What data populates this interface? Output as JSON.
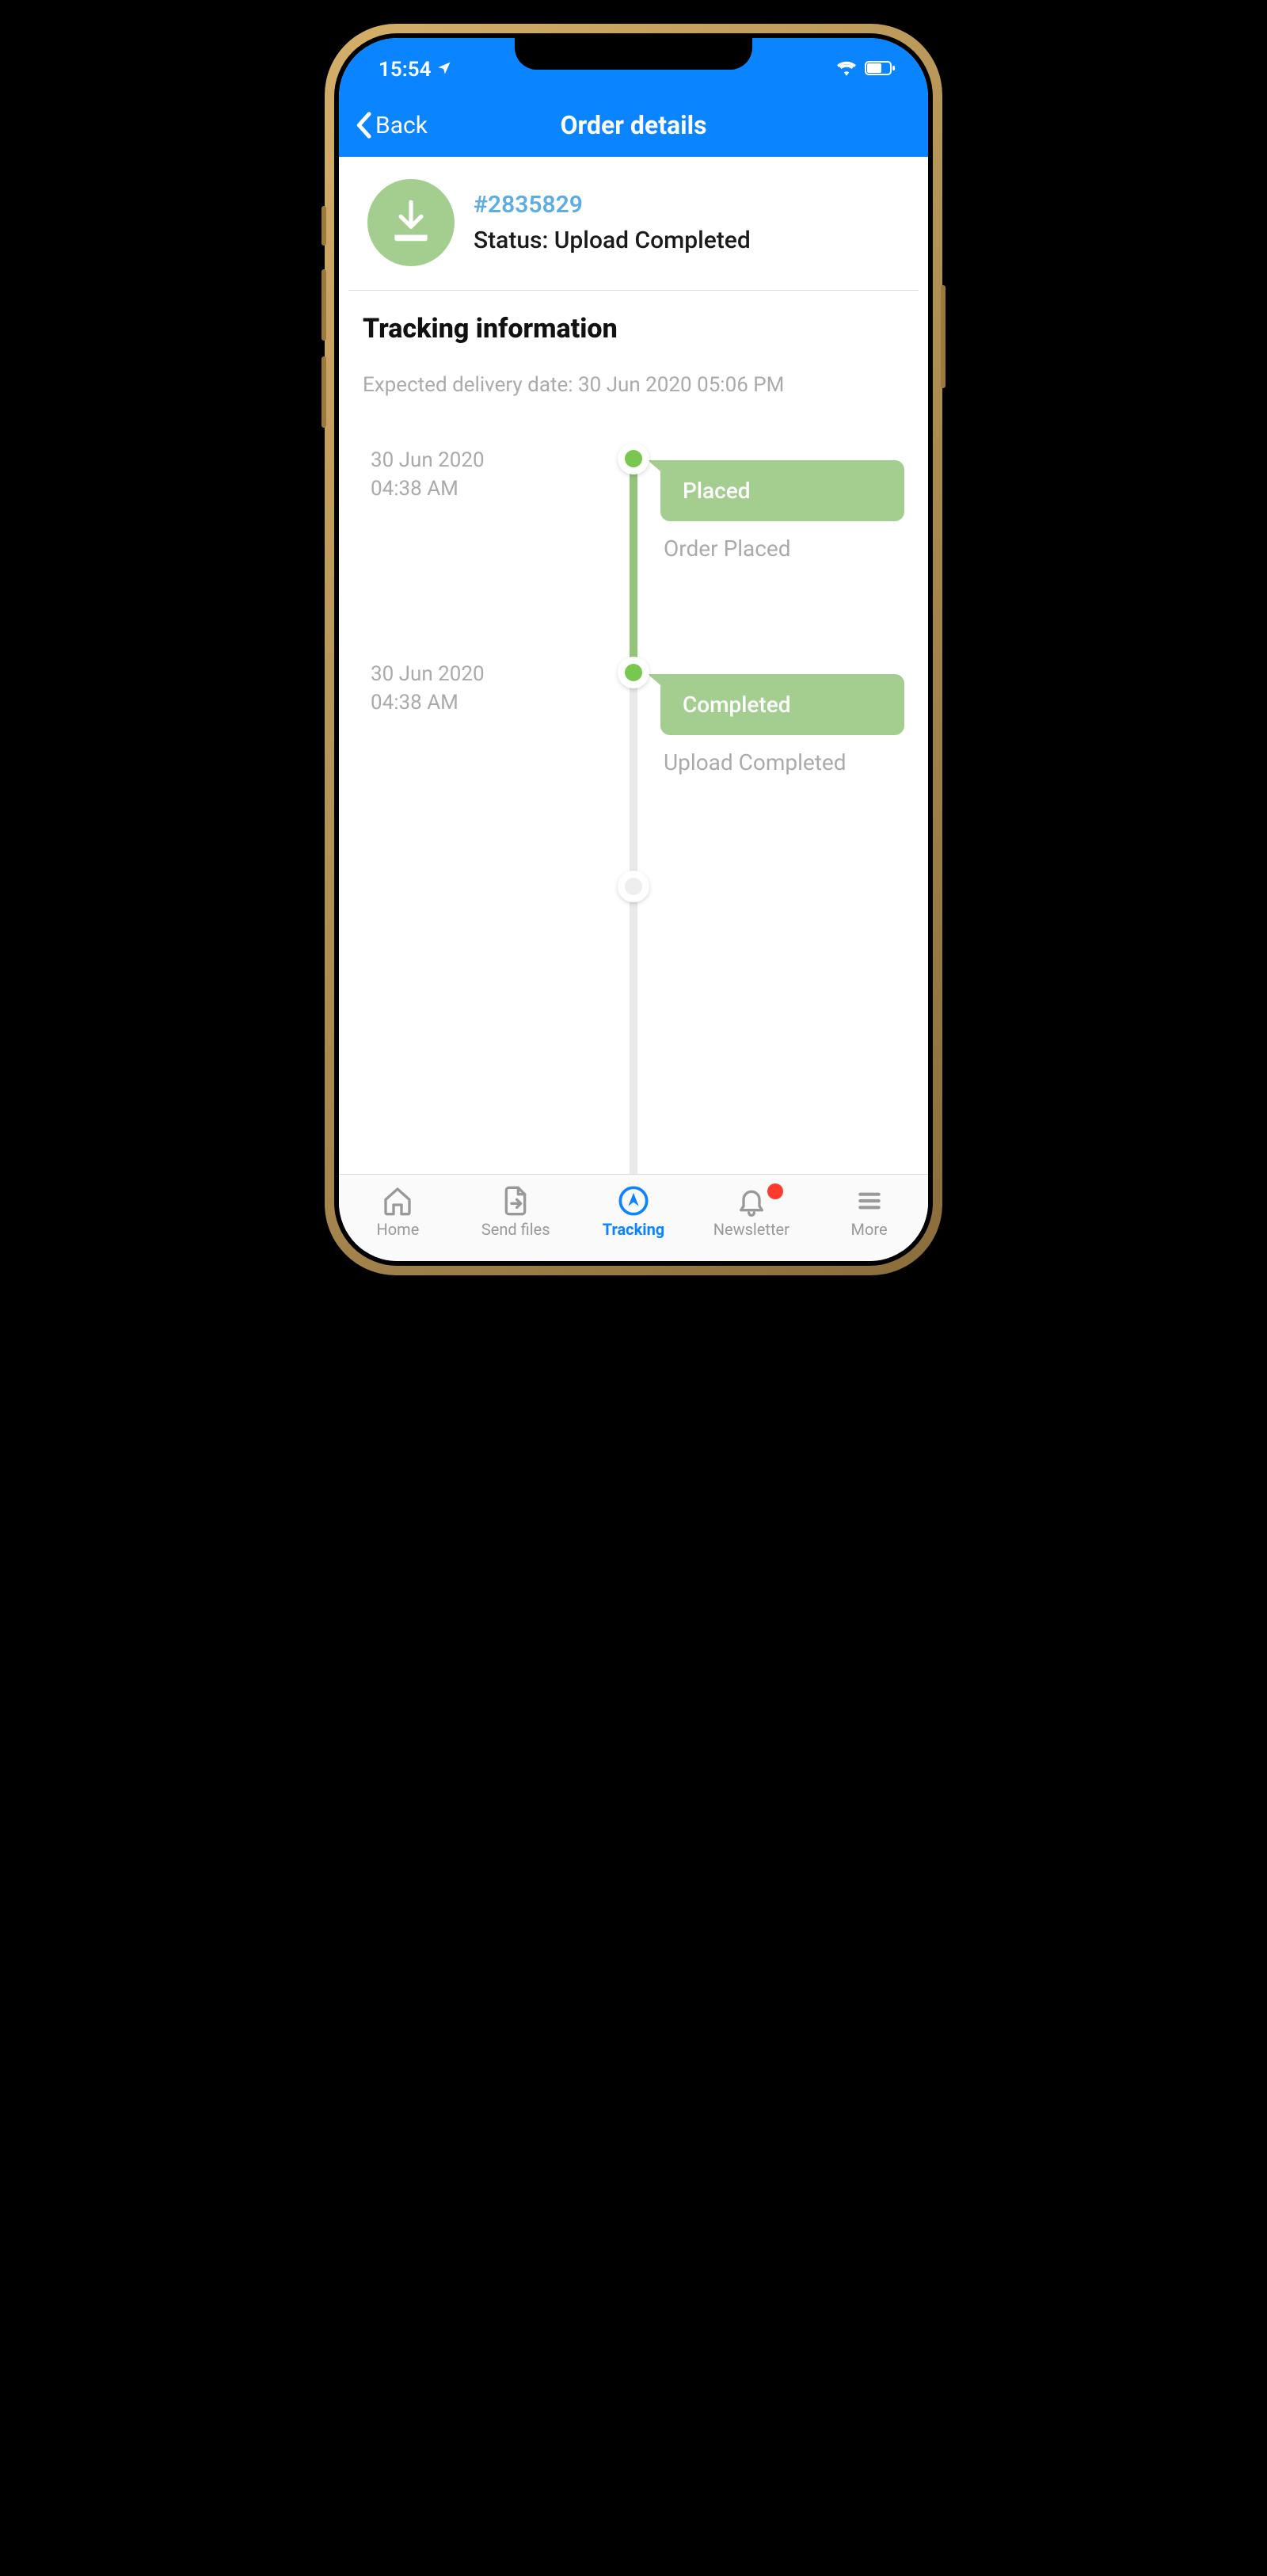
{
  "statusBar": {
    "time": "15:54"
  },
  "nav": {
    "back": "Back",
    "title": "Order details"
  },
  "order": {
    "id": "#2835829",
    "statusLabel": "Status: Upload Completed"
  },
  "tracking": {
    "title": "Tracking information",
    "expected": "Expected delivery date: 30 Jun 2020  05:06 PM"
  },
  "steps": [
    {
      "date": "30 Jun 2020",
      "time": "04:38 AM",
      "label": "Placed",
      "sub": "Order Placed"
    },
    {
      "date": "30 Jun 2020",
      "time": "04:38 AM",
      "label": "Completed",
      "sub": "Upload Completed"
    }
  ],
  "tabs": {
    "home": "Home",
    "send": "Send files",
    "tracking": "Tracking",
    "newsletter": "Newsletter",
    "more": "More"
  }
}
